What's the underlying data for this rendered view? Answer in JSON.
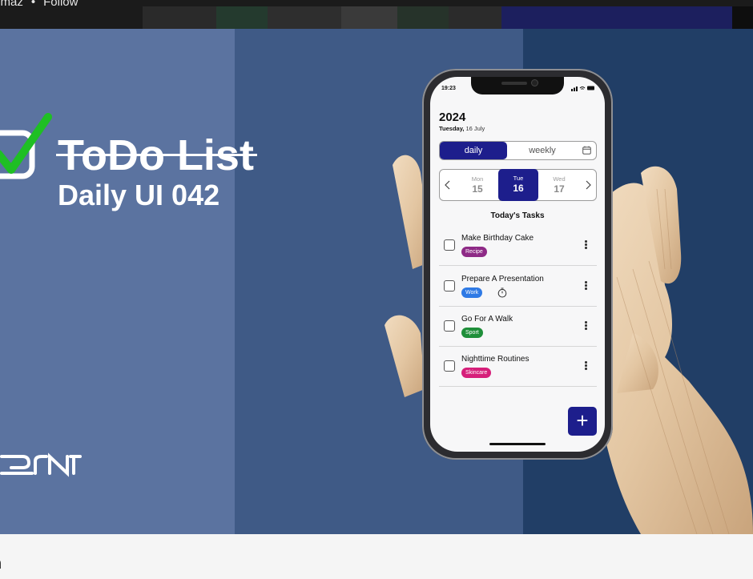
{
  "header": {
    "author_fragment": "rılmaz",
    "separator": "•",
    "follow_label": "Follow"
  },
  "hero": {
    "title": "ToDo List",
    "subtitle": "Daily UI 042",
    "brand_icon": "brand-logo-icon",
    "colors": {
      "panel_left": "#5b73a0",
      "panel_mid": "#3f5a86",
      "panel_right": "#213e66",
      "check_green": "#1fbf24"
    }
  },
  "phone": {
    "status_time": "19:23",
    "year": "2024",
    "date_weekday": "Tuesday,",
    "date_rest": "16 July",
    "tabs": {
      "daily": "daily",
      "weekly": "weekly"
    },
    "days": [
      {
        "name": "Mon",
        "num": "15"
      },
      {
        "name": "Tue",
        "num": "16"
      },
      {
        "name": "Wed",
        "num": "17"
      }
    ],
    "section_title": "Today's Tasks",
    "tasks": [
      {
        "title": "Make Birthday Cake",
        "tag": "Recipe",
        "tag_color": "#8e2a86"
      },
      {
        "title": "Prepare A Presentation",
        "tag": "Work",
        "tag_color": "#2f7ae5"
      },
      {
        "title": "Go For A Walk",
        "tag": "Sport",
        "tag_color": "#1f8f3a"
      },
      {
        "title": "Nighttime Routines",
        "tag": "Skincare",
        "tag_color": "#d61f7a"
      }
    ],
    "fab_label": "+",
    "accent": "#1d1e8c"
  },
  "footer": {
    "text_fragment": "n"
  }
}
